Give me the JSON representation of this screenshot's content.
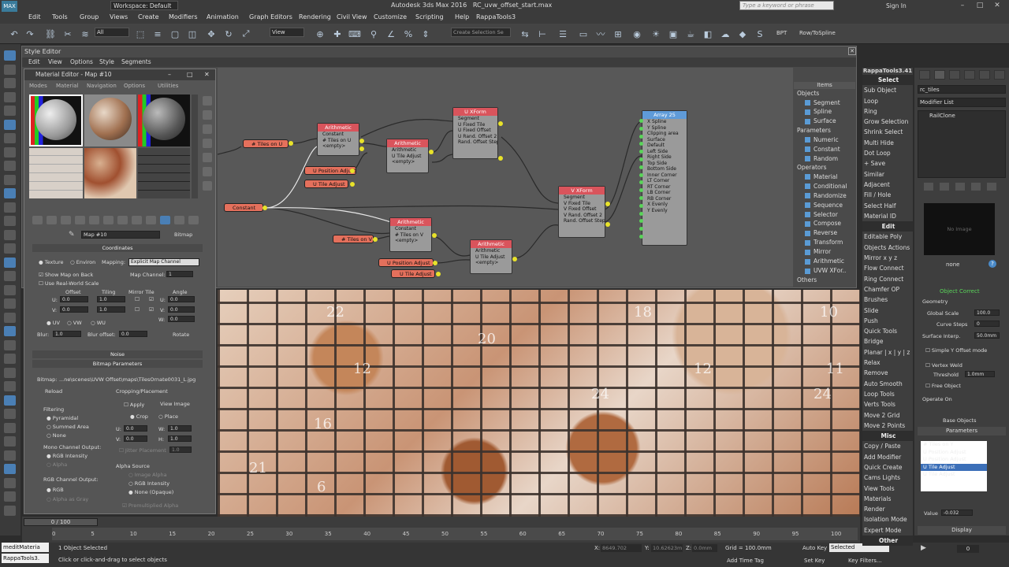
{
  "app": {
    "title": "Autodesk 3ds Max 2016",
    "file": "RC_uvw_offset_start.max",
    "workspace": "Workspace: Default",
    "search_placeholder": "Type a keyword or phrase",
    "sign_in": "Sign In"
  },
  "menubar": [
    "Edit",
    "Tools",
    "Group",
    "Views",
    "Create",
    "Modifiers",
    "Animation",
    "Graph Editors",
    "Rendering",
    "Civil View",
    "Customize",
    "Scripting",
    "Help",
    "RappaTools3"
  ],
  "toolbar": {
    "filter": "All",
    "coord": "View",
    "selset": "Create Selection Se",
    "bpt": "BPT",
    "rowtospline": "Row/ToSpline"
  },
  "style_editor": {
    "title": "Style Editor",
    "menu": [
      "Edit",
      "View",
      "Options",
      "Style",
      "Segments"
    ]
  },
  "items_panel": {
    "header": "Items",
    "groups": [
      {
        "name": "Objects",
        "items": [
          "Segment",
          "Spline",
          "Surface"
        ]
      },
      {
        "name": "Parameters",
        "items": [
          "Numeric",
          "Constant",
          "Random"
        ]
      },
      {
        "name": "Operators",
        "items": [
          "Material",
          "Conditional",
          "Randomize",
          "Sequence",
          "Selector",
          "Compose",
          "Reverse",
          "Transform",
          "Mirror",
          "Arithmetic",
          "UVW XFor.."
        ]
      },
      {
        "name": "Others",
        "items": []
      }
    ]
  },
  "graph": {
    "pills": {
      "tiles_on_u": "# Tiles on U",
      "u_pos_adjust": "U Position Adjust",
      "u_tile_adjust": "U Tile Adjust",
      "constant": "Constant",
      "tiles_on_v": "# Tiles on V",
      "u_pos_adjust2": "U Position Adjust",
      "u_tile_adjust2": "U Tile Adjust"
    },
    "nodes": {
      "arith1": {
        "title": "Arithmetic",
        "rows": [
          "Constant",
          "# Tiles on U",
          "<empty>"
        ]
      },
      "arith2": {
        "title": "Arithmetic",
        "rows": [
          "Arithmetic",
          "U Tile Adjust",
          "<empty>"
        ]
      },
      "uxform": {
        "title": "U XForm",
        "rows": [
          "Segment",
          "U Fixed Tile",
          "U Fixed Offset",
          "U Rand. Offset 2",
          "Rand. Offset Step"
        ]
      },
      "vxform": {
        "title": "V XForm",
        "rows": [
          "Segment",
          "V Fixed Tile",
          "V Fixed Offset",
          "V Rand. Offset 2",
          "Rand. Offset Step"
        ]
      },
      "arith3": {
        "title": "Arithmetic",
        "rows": [
          "Constant",
          "# Tiles on V",
          "<empty>"
        ]
      },
      "arith4": {
        "title": "Arithmetic",
        "rows": [
          "Arithmetic",
          "U Tile Adjust",
          "<empty>"
        ]
      },
      "array": {
        "title": "Array 25",
        "rows": [
          "X Spline",
          "Y Spline",
          "Clipping area",
          "Surface",
          "Default",
          "Left Side",
          "Right Side",
          "Top Side",
          "Bottom Side",
          "Inner Corner",
          "LT Corner",
          "RT Corner",
          "LB Corner",
          "RB Corner",
          "X Evenly",
          "Y Evenly"
        ]
      }
    }
  },
  "material_editor": {
    "title": "Material Editor - Map #10",
    "menu": [
      "Modes",
      "Material",
      "Navigation",
      "Options",
      "Utilities"
    ],
    "map_name": "Map #10",
    "map_type": "Bitmap",
    "coordinates": {
      "header": "Coordinates",
      "texture": "Texture",
      "environ": "Environ",
      "mapping_label": "Mapping:",
      "mapping": "Explicit Map Channel",
      "show_map": "Show Map on Back",
      "map_channel_label": "Map Channel:",
      "map_channel": "1",
      "use_real_world": "Use Real-World Scale",
      "col_offset": "Offset",
      "col_tiling": "Tiling",
      "col_mirror": "Mirror Tile",
      "col_angle": "Angle",
      "u_offset": "0.0",
      "u_tiling": "1.0",
      "u_angle": "0.0",
      "v_offset": "0.0",
      "v_tiling": "1.0",
      "v_angle": "0.0",
      "w_angle": "0.0",
      "uv": "UV",
      "vw": "VW",
      "wu": "WU",
      "blur_label": "Blur:",
      "blur": "1.0",
      "blur_offset_label": "Blur offset:",
      "blur_offset": "0.0",
      "rotate": "Rotate"
    },
    "noise": "Noise",
    "bitmap_params": {
      "header": "Bitmap Parameters",
      "bitmap_label": "Bitmap:",
      "path": "...ne\\scenes\\UVW Offset\\maps\\TilesOrnate0031_L.jpg",
      "reload": "Reload",
      "cropping": "Cropping/Placement",
      "apply": "Apply",
      "view_image": "View Image",
      "crop": "Crop",
      "place": "Place",
      "u_val": "0.0",
      "w_val": "1.0",
      "v_val": "0.0",
      "h_val": "1.0",
      "jitter": "Jitter Placement",
      "jitter_val": "1.0",
      "filtering": "Filtering",
      "pyramidal": "Pyramidal",
      "summed": "Summed Area",
      "none": "None",
      "mono": "Mono Channel Output:",
      "rgb_int": "RGB Intensity",
      "alpha": "Alpha",
      "rgb_out": "RGB Channel Output:",
      "rgb": "RGB",
      "alpha_gray": "Alpha as Gray",
      "alpha_src": "Alpha Source",
      "img_alpha": "Image Alpha",
      "rgb_int2": "RGB Intensity",
      "none_opaque": "None (Opaque)",
      "premult": "Premultiplied Alpha"
    }
  },
  "viewport": {
    "numbers": [
      "22",
      "10",
      "11",
      "18",
      "12",
      "20",
      "12",
      "24",
      "24",
      "16",
      "6",
      "21"
    ]
  },
  "timeline": {
    "frame": "0 / 100",
    "ticks": [
      "0",
      "5",
      "10",
      "15",
      "20",
      "25",
      "30",
      "35",
      "40",
      "45",
      "50",
      "55",
      "60",
      "65",
      "70",
      "75",
      "80",
      "85",
      "90",
      "95",
      "100"
    ]
  },
  "status": {
    "script_1": "meditMateria",
    "script_2": "RappaTools3.",
    "selected": "1 Object Selected",
    "prompt": "Click or click-and-drag to select objects",
    "x": "8649.702",
    "y": "10.62623m",
    "z": "0.0mm",
    "grid": "Grid = 100.0mm",
    "add_time_tag": "Add Time Tag",
    "auto_key": "Auto Key",
    "auto_key_sel": "Selected",
    "set_key": "Set Key",
    "key_filters": "Key Filters...",
    "frame_num": "0"
  },
  "rappa": {
    "title": "RappaTools3.41",
    "items": [
      {
        "t": "Select",
        "hd": true
      },
      "Sub Object",
      "Loop",
      "Ring",
      "Grow Selection",
      "Shrink Select",
      "Multi Hide",
      "Dot Loop",
      "+ Save",
      "Similar",
      "Adjacent",
      "Fill / Hole",
      "Select Half",
      "Material ID",
      {
        "t": "Edit",
        "hd": true
      },
      "Editable Poly",
      "Objects Actions",
      "Mirror  x y z",
      "Flow Connect",
      "Ring Connect",
      "Chamfer OP",
      "Brushes",
      "Slide",
      "Push",
      "Quick Tools",
      "Bridge",
      "Planar | x | y | z",
      "Relax",
      "Remove",
      "Auto Smooth",
      "Loop Tools",
      "Verts Tools",
      "Move 2 Grid",
      "Move 2 Points",
      {
        "t": "Misc",
        "hd": true
      },
      "Copy / Paste",
      "Add Modifier",
      "Quick Create",
      "Cams Lights",
      "View Tools",
      "Materials",
      "Render",
      "Isolation Mode",
      "Expert Mode",
      {
        "t": "Other",
        "hd": true
      }
    ]
  },
  "cmd": {
    "obj_name": "rc_tiles",
    "modifier_list": "Modifier List",
    "stack_item": "RailClone",
    "no_image": "No Image",
    "none": "none",
    "object_correct": "Object Correct",
    "geometry": "Geometry",
    "global_scale_lbl": "Global Scale",
    "global_scale": "100.0",
    "curve_steps_lbl": "Curve Steps",
    "curve_steps": "0",
    "surface_interp_lbl": "Surface Interp.",
    "surface_interp": "50.0mm",
    "simple_y": "Simple Y Offset mode",
    "vertex_weld": "Vertex Weld",
    "threshold_lbl": "Threshold",
    "threshold": "1.0mm",
    "free_object": "Free Object",
    "operate_on": "Operate On",
    "base_objects": "Base Objects",
    "parameters": "Parameters",
    "params": [
      "# Tiles on Y",
      "U Position Adjust",
      "U Position Adjust",
      "U Tile Adjust",
      "U Tile Adjust"
    ],
    "value_lbl": "Value",
    "value": "-0.032",
    "display": "Display"
  }
}
